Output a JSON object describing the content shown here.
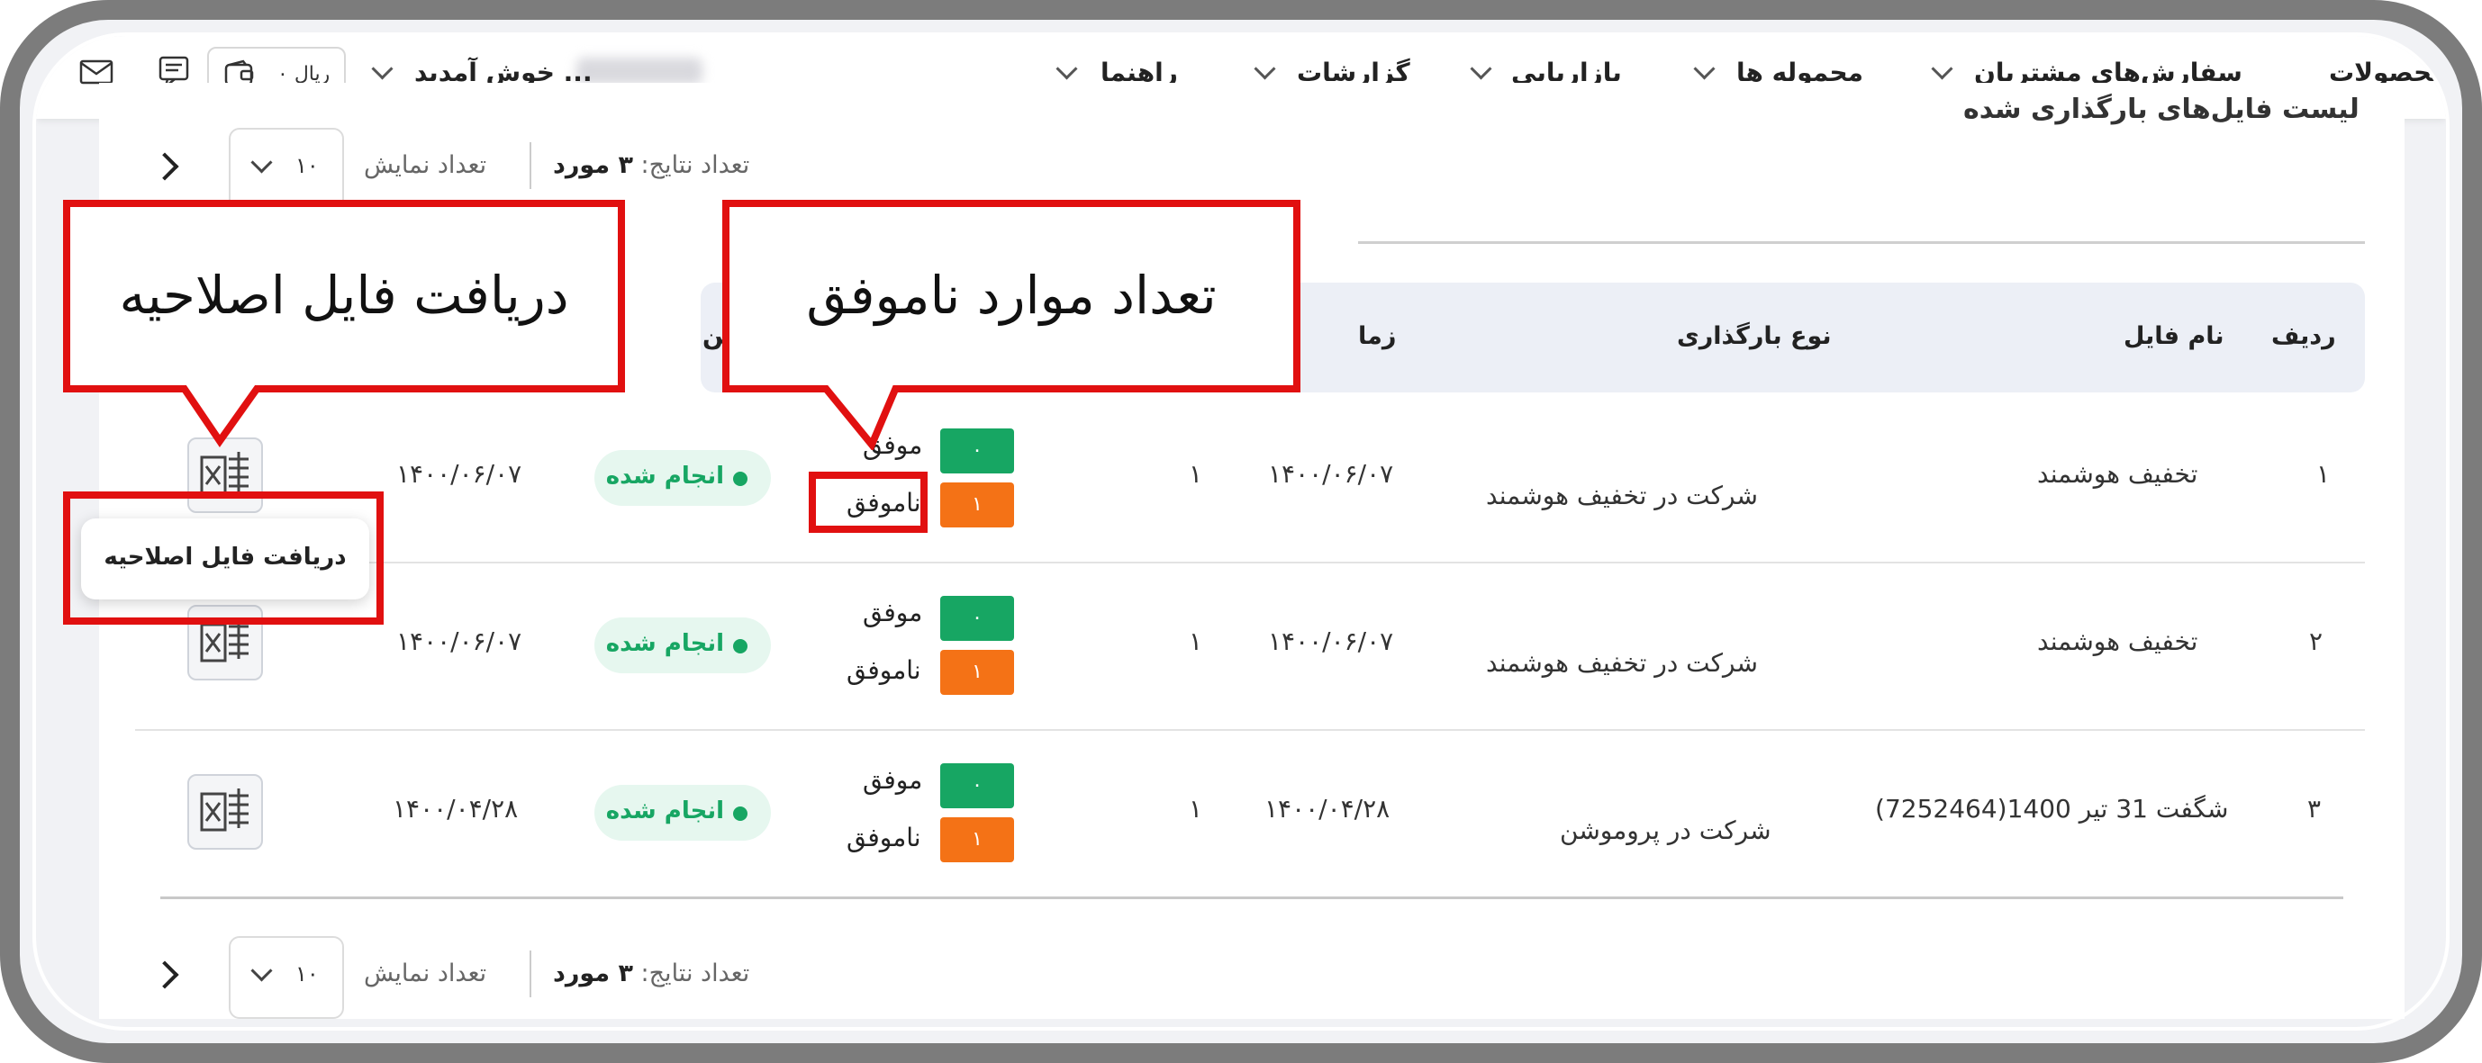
{
  "nav": {
    "items": [
      "محصولات",
      "سفارش‌های مشتریان",
      "محموله ها",
      "بازاریابی",
      "گزارشات",
      "راهنما"
    ],
    "welcome": "خوش آمدید ...",
    "wallet": "۰ ریال"
  },
  "page": {
    "title": "لیست فایل‌های بارگذاری شده"
  },
  "pager": {
    "results_label": "تعداد نتایج:",
    "results_value": "۳ مورد",
    "show_label": "تعداد نمایش",
    "page_size": "۱۰"
  },
  "table": {
    "headers": {
      "row": "ردیف",
      "file_name": "نام فایل",
      "upload_type": "نوع بارگذاری",
      "time": "زما",
      "status_col": "ین"
    },
    "rows": [
      {
        "idx": "۱",
        "file_name": "تخفیف هوشمند",
        "upload_type": "شرکت در تخفیف هوشمند",
        "date": "۱۴۰۰/۰۶/۰۷",
        "count": "۱",
        "success_count": "۰",
        "fail_count": "۱",
        "success_label": "موفق",
        "fail_label": "ناموفق",
        "status": "انجام شده",
        "date2": "۱۴۰۰/۰۶/۰۷"
      },
      {
        "idx": "۲",
        "file_name": "تخفیف هوشمند",
        "upload_type": "شرکت در تخفیف هوشمند",
        "date": "۱۴۰۰/۰۶/۰۷",
        "count": "۱",
        "success_count": "۰",
        "fail_count": "۱",
        "success_label": "موفق",
        "fail_label": "ناموفق",
        "status": "انجام شده",
        "date2": "۱۴۰۰/۰۶/۰۷"
      },
      {
        "idx": "۳",
        "file_name": "شگفت 31 تیر 1400(7252464)",
        "upload_type": "شرکت در پروموشن",
        "date": "۱۴۰۰/۰۴/۲۸",
        "count": "۱",
        "success_count": "۰",
        "fail_count": "۱",
        "success_label": "موفق",
        "fail_label": "ناموفق",
        "status": "انجام شده",
        "date2": "۱۴۰۰/۰۴/۲۸"
      }
    ]
  },
  "tooltip": {
    "text": "دریافت فایل اصلاحیه"
  },
  "callouts": {
    "failed_count": "تعداد موارد ناموفق",
    "download_fix": "دریافت فایل اصلاحیه"
  },
  "colors": {
    "accent_red": "#e11010",
    "success": "#17a663",
    "fail": "#f47216"
  }
}
